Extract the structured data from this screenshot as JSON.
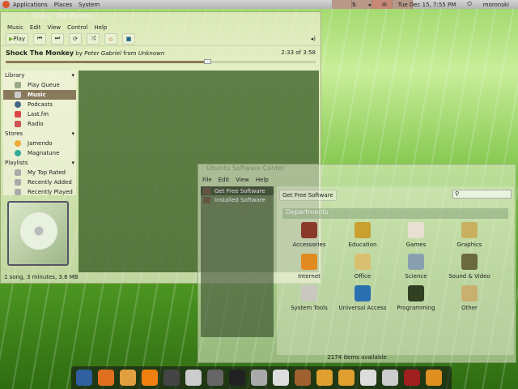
{
  "panel": {
    "menus": [
      "Applications",
      "Places",
      "System"
    ],
    "clock": "Tue Dec 15,  7:55 PM",
    "user": "moronski"
  },
  "rhythmbox": {
    "title": "Shock The Monkey",
    "menu": [
      "Music",
      "Edit",
      "View",
      "Control",
      "Help"
    ],
    "play_label": "Play",
    "song": {
      "title": "Shock The Monkey",
      "by": "by",
      "artist": "Peter Gabriel",
      "from": "from",
      "album": "Unknown",
      "time": "2:33 of 3:58",
      "progress": 0.65
    },
    "sidebar": {
      "library": "Library",
      "library_items": [
        "Play Queue",
        "Music",
        "Podcasts",
        "Last.fm",
        "Radio"
      ],
      "stores": "Stores",
      "store_items": [
        "Jamendo",
        "Magnatune"
      ],
      "playlists": "Playlists",
      "playlist_items": [
        "My Top Rated",
        "Recently Added",
        "Recently Played"
      ]
    },
    "status": "1 song, 3 minutes, 3.6 MB"
  },
  "software_center": {
    "title": "Ubuntu Software Center",
    "menu": [
      "File",
      "Edit",
      "View",
      "Help"
    ],
    "nav": [
      "Get Free Software",
      "Installed Software"
    ],
    "breadcrumb": "Get Free Software",
    "departments": "Departments",
    "categories": [
      {
        "label": "Accessories",
        "color": "#8a3a2a"
      },
      {
        "label": "Education",
        "color": "#c9a030"
      },
      {
        "label": "Games",
        "color": "#e8e0d0"
      },
      {
        "label": "Graphics",
        "color": "#c8b060"
      },
      {
        "label": "Internet",
        "color": "#e08a20"
      },
      {
        "label": "Office",
        "color": "#d8c070"
      },
      {
        "label": "Science",
        "color": "#8aa0b0"
      },
      {
        "label": "Sound & Video",
        "color": "#6a6a40"
      },
      {
        "label": "System Tools",
        "color": "#c8c8c0"
      },
      {
        "label": "Universal Access",
        "color": "#2a70b0"
      },
      {
        "label": "Programming",
        "color": "#304020"
      },
      {
        "label": "Other",
        "color": "#c8b070"
      }
    ],
    "status": "2174 items available"
  },
  "dock": {
    "icons": [
      "ubuntu-one",
      "firefox",
      "vuze",
      "vlc",
      "clapper",
      "pidgin",
      "calculator",
      "terminal",
      "camera",
      "printer",
      "tool",
      "folder",
      "folder",
      "ipod",
      "mail",
      "presentation",
      "archive"
    ],
    "colors": [
      "#3060a0",
      "#e07020",
      "#e0a040",
      "#f08010",
      "#444",
      "#ccc",
      "#666",
      "#222",
      "#aaa",
      "#ddd",
      "#a06030",
      "#e0a030",
      "#e0a030",
      "#ddd",
      "#ccc",
      "#a02020",
      "#e09020"
    ]
  }
}
